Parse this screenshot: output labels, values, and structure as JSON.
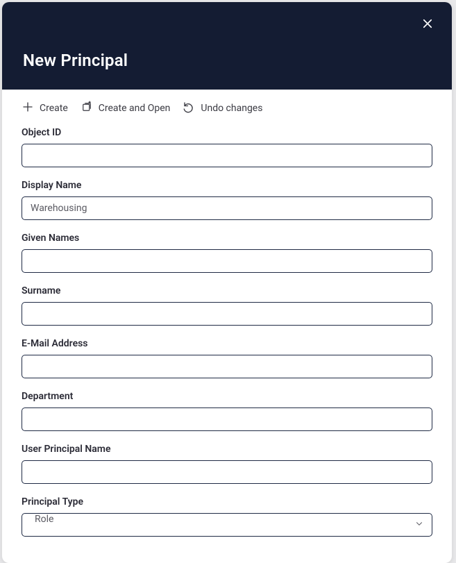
{
  "header": {
    "title": "New Principal"
  },
  "toolbar": {
    "create_label": "Create",
    "create_open_label": "Create and Open",
    "undo_label": "Undo changes"
  },
  "fields": {
    "object_id": {
      "label": "Object ID",
      "value": ""
    },
    "display_name": {
      "label": "Display Name",
      "value": "Warehousing"
    },
    "given_names": {
      "label": "Given Names",
      "value": ""
    },
    "surname": {
      "label": "Surname",
      "value": ""
    },
    "email": {
      "label": "E-Mail Address",
      "value": ""
    },
    "department": {
      "label": "Department",
      "value": ""
    },
    "upn": {
      "label": "User Principal Name",
      "value": ""
    },
    "principal_type": {
      "label": "Principal Type",
      "value": "Role"
    }
  }
}
